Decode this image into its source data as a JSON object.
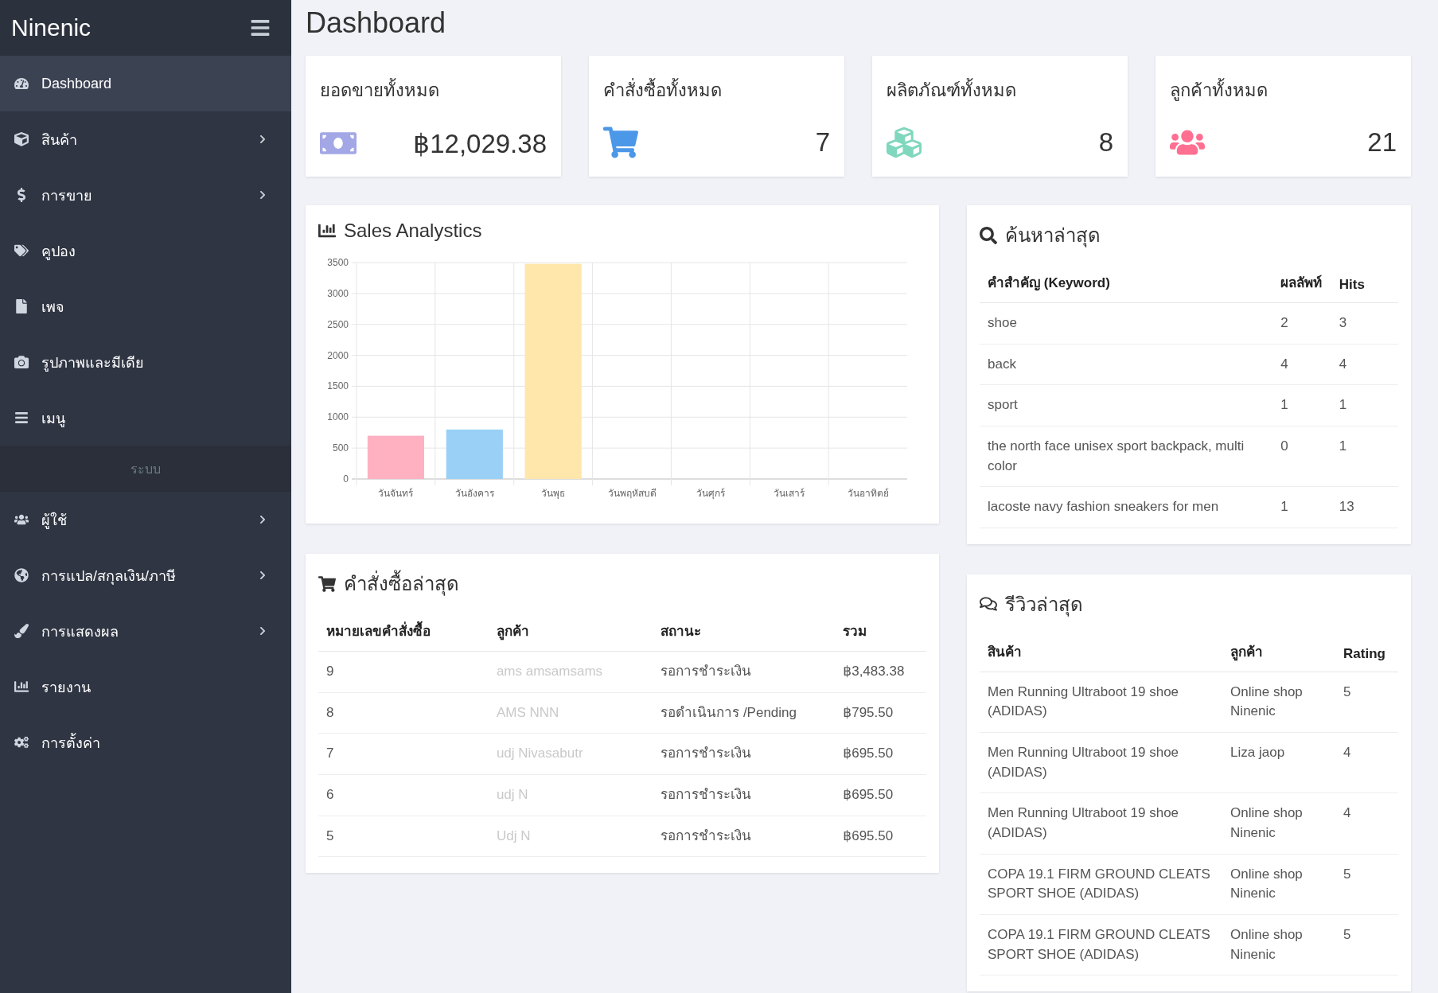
{
  "sidebar": {
    "brand": "Ninenic",
    "groups": [
      {
        "items": [
          {
            "label": "Dashboard",
            "selected": true,
            "has_submenu": false
          },
          {
            "label": "สินค้า",
            "selected": false,
            "has_submenu": true
          },
          {
            "label": "การขาย",
            "selected": false,
            "has_submenu": true
          },
          {
            "label": "คูปอง",
            "selected": false,
            "has_submenu": false
          },
          {
            "label": "เพจ",
            "selected": false,
            "has_submenu": false
          },
          {
            "label": "รูปภาพและมีเดีย",
            "selected": false,
            "has_submenu": false
          },
          {
            "label": "เมนู",
            "selected": false,
            "has_submenu": false
          }
        ]
      },
      {
        "heading": "ระบบ",
        "items": [
          {
            "label": "ผู้ใช้",
            "selected": false,
            "has_submenu": true
          },
          {
            "label": "การแปล/สกุลเงิน/ภาษี",
            "selected": false,
            "has_submenu": true
          },
          {
            "label": "การแสดงผล",
            "selected": false,
            "has_submenu": true
          },
          {
            "label": "รายงาน",
            "selected": false,
            "has_submenu": false
          },
          {
            "label": "การตั้งค่า",
            "selected": false,
            "has_submenu": false
          }
        ]
      }
    ]
  },
  "page_title": "Dashboard",
  "stat_cards": [
    {
      "title": "ยอดขายทั้งหมด",
      "value": "฿12,029.38"
    },
    {
      "title": "คำสั่งซื้อทั้งหมด",
      "value": "7"
    },
    {
      "title": "ผลิตภัณฑ์ทั้งหมด",
      "value": "8"
    },
    {
      "title": "ลูกค้าทั้งหมด",
      "value": "21"
    }
  ],
  "sales_panel": {
    "title": "Sales Analystics",
    "chart_data": {
      "type": "bar",
      "categories": [
        "วันจันทร์",
        "วันอังคาร",
        "วันพุธ",
        "วันพฤหัสบดี",
        "วันศุกร์",
        "วันเสาร์",
        "วันอาทิตย์"
      ],
      "values": [
        700,
        800,
        3480,
        0,
        0,
        0,
        0
      ],
      "grid": true,
      "ylim": [
        0,
        3500
      ],
      "yticks": [
        0,
        500,
        1000,
        1500,
        2000,
        2500,
        3000,
        3500
      ]
    }
  },
  "orders_panel": {
    "title": "คำสั่งซื้อล่าสุด",
    "columns": [
      "หมายเลขคำสั่งซื้อ",
      "ลูกค้า",
      "สถานะ",
      "รวม"
    ],
    "rows": [
      [
        "9",
        "ams amsamsams",
        "รอการชำระเงิน",
        "฿3,483.38"
      ],
      [
        "8",
        "AMS NNN",
        "รอดำเนินการ /Pending",
        "฿795.50"
      ],
      [
        "7",
        "udj Nivasabutr",
        "รอการชำระเงิน",
        "฿695.50"
      ],
      [
        "6",
        "udj N",
        "รอการชำระเงิน",
        "฿695.50"
      ],
      [
        "5",
        "Udj N",
        "รอการชำระเงิน",
        "฿695.50"
      ]
    ]
  },
  "search_panel": {
    "title": "ค้นหาล่าสุด",
    "columns": [
      "คำสำคัญ (Keyword)",
      "ผลลัพท์",
      "Hits"
    ],
    "rows": [
      [
        "shoe",
        "2",
        "3"
      ],
      [
        "back",
        "4",
        "4"
      ],
      [
        "sport",
        "1",
        "1"
      ],
      [
        "the north face unisex sport backpack, multi color",
        "0",
        "1"
      ],
      [
        "lacoste navy fashion sneakers for men",
        "1",
        "13"
      ]
    ]
  },
  "reviews_panel": {
    "title": "รีวิวล่าสุด",
    "columns": [
      "สินค้า",
      "ลูกค้า",
      "Rating"
    ],
    "rows": [
      [
        "Men Running Ultraboot 19 shoe (ADIDAS)",
        "Online shop Ninenic",
        "5"
      ],
      [
        "Men Running Ultraboot 19 shoe (ADIDAS)",
        "Liza jaop",
        "4"
      ],
      [
        "Men Running Ultraboot 19 shoe (ADIDAS)",
        "Online shop Ninenic",
        "4"
      ],
      [
        "COPA 19.1 FIRM GROUND CLEATS SPORT SHOE (ADIDAS)",
        "Online shop Ninenic",
        "5"
      ],
      [
        "COPA 19.1 FIRM GROUND CLEATS SPORT SHOE (ADIDAS)",
        "Online shop Ninenic",
        "5"
      ]
    ]
  }
}
